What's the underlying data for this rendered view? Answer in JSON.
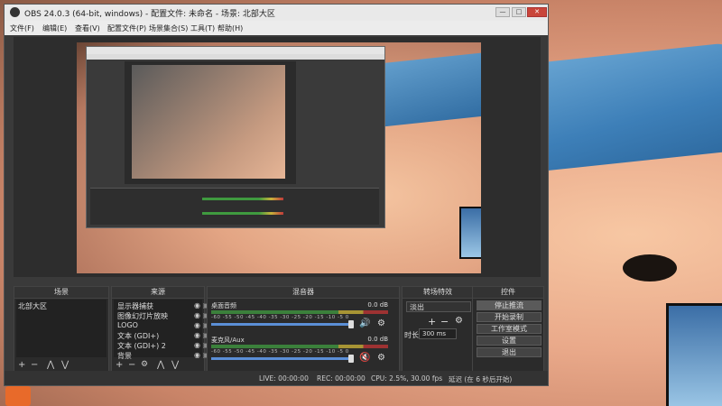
{
  "window": {
    "title": "OBS 24.0.3 (64-bit, windows) - 配置文件: 未命名 - 场景: 北部大区",
    "minimize": "—",
    "maximize": "□",
    "close": "✕"
  },
  "menu": [
    "文件(F)",
    "编辑(E)",
    "查看(V)",
    "配置文件(P)",
    "场景集合(S)",
    "工具(T)",
    "帮助(H)"
  ],
  "docks": {
    "scenes": {
      "title": "场景",
      "items": [
        "北部大区"
      ]
    },
    "sources": {
      "title": "来源",
      "items": [
        "显示器捕获",
        "图像幻灯片放映",
        "LOGO",
        "文本 (GDI+)",
        "文本 (GDI+) 2",
        "背景"
      ]
    },
    "mixer": {
      "title": "混音器",
      "channels": [
        {
          "name": "桌面音频",
          "db": "0.0 dB",
          "muted": false
        },
        {
          "name": "麦克风/Aux",
          "db": "0.0 dB",
          "muted": true
        }
      ],
      "scale": "-60  -55  -50  -45  -40  -35  -30  -25  -20  -15  -10  -5  0"
    },
    "transitions": {
      "title": "转场特效",
      "selected": "淡出",
      "duration_label": "时长",
      "duration": "300 ms"
    },
    "controls": {
      "title": "控件",
      "buttons": [
        "停止推流",
        "开始录制",
        "工作室模式",
        "设置",
        "退出"
      ]
    }
  },
  "foot_icons": {
    "add": "+",
    "remove": "−",
    "up": "⋀",
    "down": "⋁",
    "gear": "⚙"
  },
  "status": {
    "live": "LIVE: 00:00:00",
    "rec": "REC: 00:00:00",
    "cpu": "CPU: 2.5%, 30.00 fps",
    "delay": "延迟 (在 6 秒后开始)"
  },
  "colors": {
    "window_bg": "#3a3a3a",
    "dock_bg": "#2b2b2b",
    "accent_slider": "#5b8fd6",
    "muted": "#dd3333"
  }
}
